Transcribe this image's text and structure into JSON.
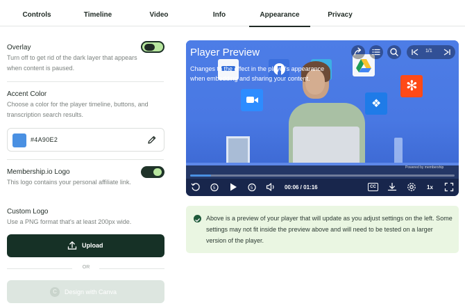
{
  "tabs": [
    {
      "label": "Controls",
      "active": false
    },
    {
      "label": "Timeline",
      "active": false
    },
    {
      "label": "Video",
      "active": false
    },
    {
      "label": "Info",
      "active": false
    },
    {
      "label": "Appearance",
      "active": true
    },
    {
      "label": "Privacy",
      "active": false
    }
  ],
  "overlay": {
    "label": "Overlay",
    "description": "Turn off to get rid of the dark layer that appears when content is paused.",
    "enabled": false
  },
  "accent": {
    "label": "Accent Color",
    "description": "Choose a color for the player timeline, buttons, and transcription search results.",
    "value": "#4A90E2",
    "swatch_color": "#4A90E2"
  },
  "membership_logo": {
    "label": "Membership.io Logo",
    "description": "This logo contains your personal affiliate link.",
    "enabled": true
  },
  "custom_logo": {
    "label": "Custom Logo",
    "description": "Use a PNG format that's at least 200px wide.",
    "upload_label": "Upload",
    "or_label": "OR",
    "canva_label": "Design with Canva"
  },
  "player": {
    "title": "Player Preview",
    "description": "Changes to the effect in the player's appearance when embedding and sharing your content.",
    "page_indicator": "1/1",
    "time": "00:06 / 01:16",
    "speed": "1x",
    "cc_label": "CC",
    "progress": 0.08,
    "powered_by": "Powered by membership"
  },
  "info_box": {
    "text": "Above is a preview of your player that will update as you adjust settings on the left. Some settings may not fit inside the preview above and will need to be tested on a larger version of the player."
  },
  "colors": {
    "dark_green": "#163126",
    "accent_green": "#b8e79f",
    "player_blue": "#4A90E2",
    "info_bg": "#eaf6e2"
  }
}
